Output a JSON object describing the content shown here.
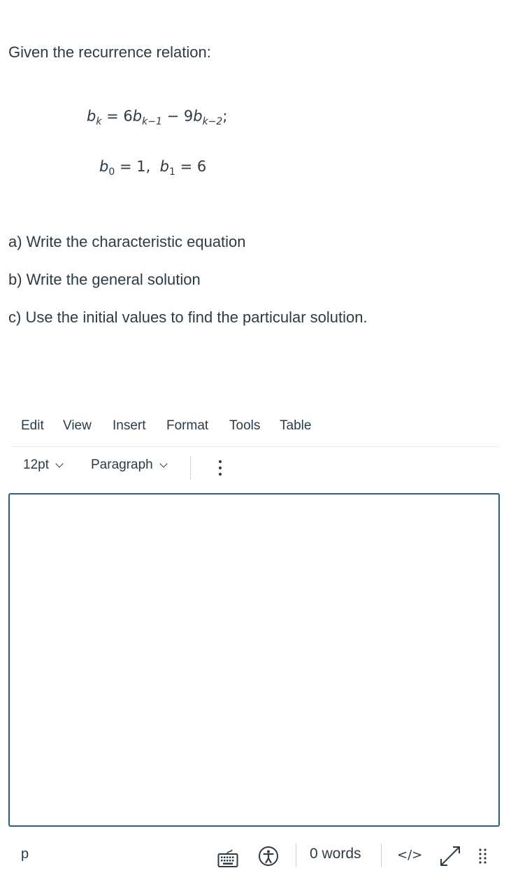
{
  "question": {
    "intro": "Given the recurrence relation:",
    "equation_line1": {
      "lhs_var": "b",
      "lhs_sub": "k",
      "rhs_coef1": "6",
      "rhs_var1": "b",
      "rhs_sub1": "k−1",
      "operator": "−",
      "rhs_coef2": "9",
      "rhs_var2": "b",
      "rhs_sub2": "k−2",
      "terminator": ";"
    },
    "equation_line2": {
      "var0": "b",
      "sub0": "0",
      "val0": "1,",
      "var1": "b",
      "sub1": "1",
      "val1": "6"
    },
    "parts": [
      "a)  Write the characteristic equation",
      "b)  Write the general solution",
      "c)  Use the initial values to find the particular solution."
    ]
  },
  "editor": {
    "menubar": [
      "Edit",
      "View",
      "Insert",
      "Format",
      "Tools",
      "Table"
    ],
    "toolbar": {
      "font_size": "12pt",
      "block_format": "Paragraph"
    },
    "content": "",
    "statusbar": {
      "path": "p",
      "word_count": "0 words",
      "code_view": "</>"
    },
    "icons": {
      "keyboard": "keyboard-icon",
      "accessibility": "accessibility-icon",
      "fullscreen": "fullscreen-expand-icon",
      "resize": "resize-grip-icon",
      "more": "more-vertical-icon"
    },
    "colors": {
      "text": "#2d3b45",
      "editor_border": "#2a5f7d",
      "divider": "#c7cdd1"
    }
  }
}
